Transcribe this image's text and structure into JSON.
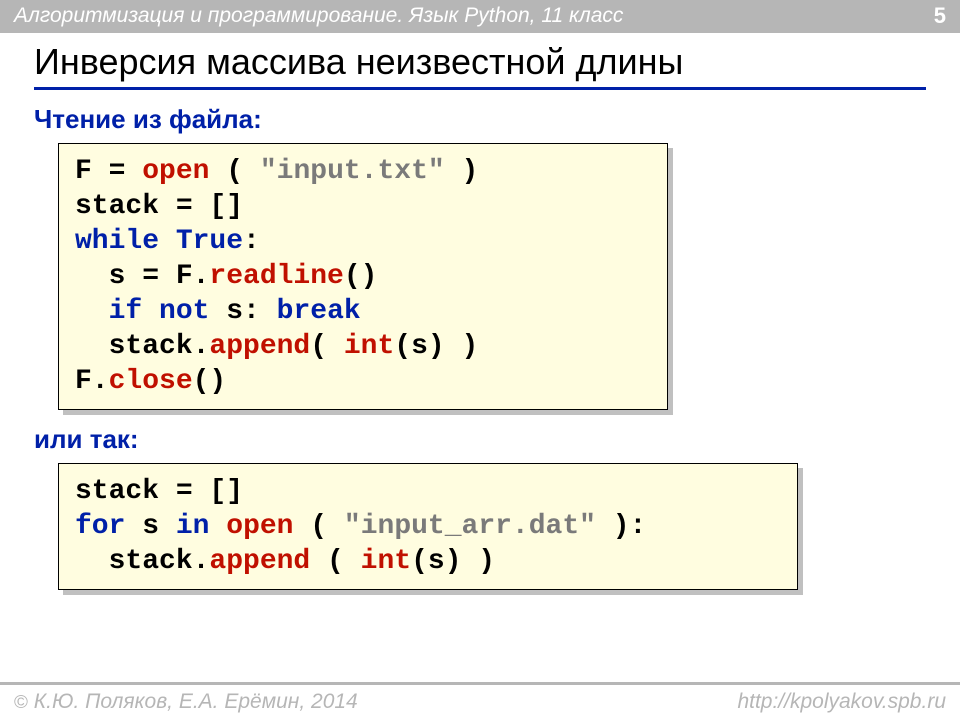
{
  "header": {
    "subject": "Алгоритмизация и программирование. Язык Python, 11 класс",
    "page": "5"
  },
  "title": "Инверсия массива неизвестной длины",
  "section1": {
    "label": "Чтение из файла:",
    "code": {
      "l1a": "F = ",
      "l1b": "open",
      "l1c": " ( ",
      "l1d": "\"input.txt\"",
      "l1e": " )",
      "l2": "stack = []",
      "l3a": "while True",
      "l3b": ":",
      "l4a": "  s = F.",
      "l4b": "readline",
      "l4c": "()",
      "l5a": "  ",
      "l5b": "if not",
      "l5c": " s: ",
      "l5d": "break",
      "l6a": "  stack.",
      "l6b": "append",
      "l6c": "( ",
      "l6d": "int",
      "l6e": "(s) )",
      "l7a": "F.",
      "l7b": "close",
      "l7c": "()"
    }
  },
  "section2": {
    "label": "или так:",
    "code": {
      "l1": "stack = []",
      "l2a": "for",
      "l2b": " s ",
      "l2c": "in",
      "l2d": " ",
      "l2e": "open",
      "l2f": " ( ",
      "l2g": "\"input_arr.dat\"",
      "l2h": " ):",
      "l3a": "  stack.",
      "l3b": "append",
      "l3c": " ( ",
      "l3d": "int",
      "l3e": "(s) )"
    }
  },
  "footer": {
    "copyright": " К.Ю. Поляков, Е.А. Ерёмин, 2014",
    "url": "http://kpolyakov.spb.ru"
  }
}
